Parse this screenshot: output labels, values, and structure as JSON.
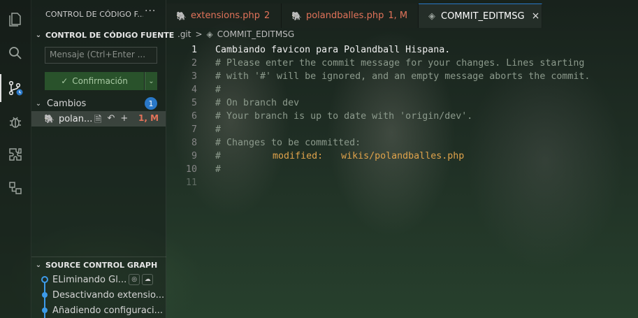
{
  "activity_bar": {
    "items": [
      "explorer-icon",
      "search-icon",
      "source-control-icon",
      "debug-icon",
      "extensions-icon",
      "remote-explorer-icon"
    ]
  },
  "sidebar": {
    "header": "CONTROL DE CÓDIGO F...",
    "more": "···",
    "section_title": "CONTROL DE CÓDIGO FUENTE",
    "message_placeholder": "Mensaje (Ctrl+Enter ...",
    "commit_button": "Confirmación",
    "changes_label": "Cambios",
    "changes_count": "1",
    "file": {
      "name": "polan...",
      "status": "1, M"
    },
    "graph_title": "SOURCE CONTROL GRAPH",
    "graph_items": [
      "ELiminando Gl...",
      "Desactivando extensio...",
      "Añadiendo configuraci..."
    ]
  },
  "tabs": [
    {
      "label": "extensions.php",
      "status": "2"
    },
    {
      "label": "polandballes.php",
      "status": "1, M"
    },
    {
      "label": "COMMIT_EDITMSG",
      "close": "×"
    }
  ],
  "breadcrumb": {
    "folder": ".git",
    "separator": ">",
    "file": "COMMIT_EDITMSG"
  },
  "editor": {
    "lines": [
      {
        "n": "1",
        "text": "Cambiando favicon para Polandball Hispana."
      },
      {
        "n": "2",
        "text": "# Please enter the commit message for your changes. Lines starting"
      },
      {
        "n": "3",
        "text": "# with '#' will be ignored, and an empty message aborts the commit."
      },
      {
        "n": "4",
        "text": "#"
      },
      {
        "n": "5",
        "text": "# On branch dev"
      },
      {
        "n": "6",
        "text": "# Your branch is up to date with 'origin/dev'."
      },
      {
        "n": "7",
        "text": "#"
      },
      {
        "n": "8",
        "text": "# Changes to be committed:"
      },
      {
        "n": "9",
        "prefix": "#\t",
        "mod_label": "modified:",
        "mod_path": "wikis/polandballes.php"
      },
      {
        "n": "10",
        "text": "#"
      },
      {
        "n": "11",
        "text": ""
      }
    ]
  },
  "colors": {
    "accent": "#2a78c8",
    "modified": "#e2735a",
    "php": "#a074c4",
    "graph": "#3d9be9"
  }
}
